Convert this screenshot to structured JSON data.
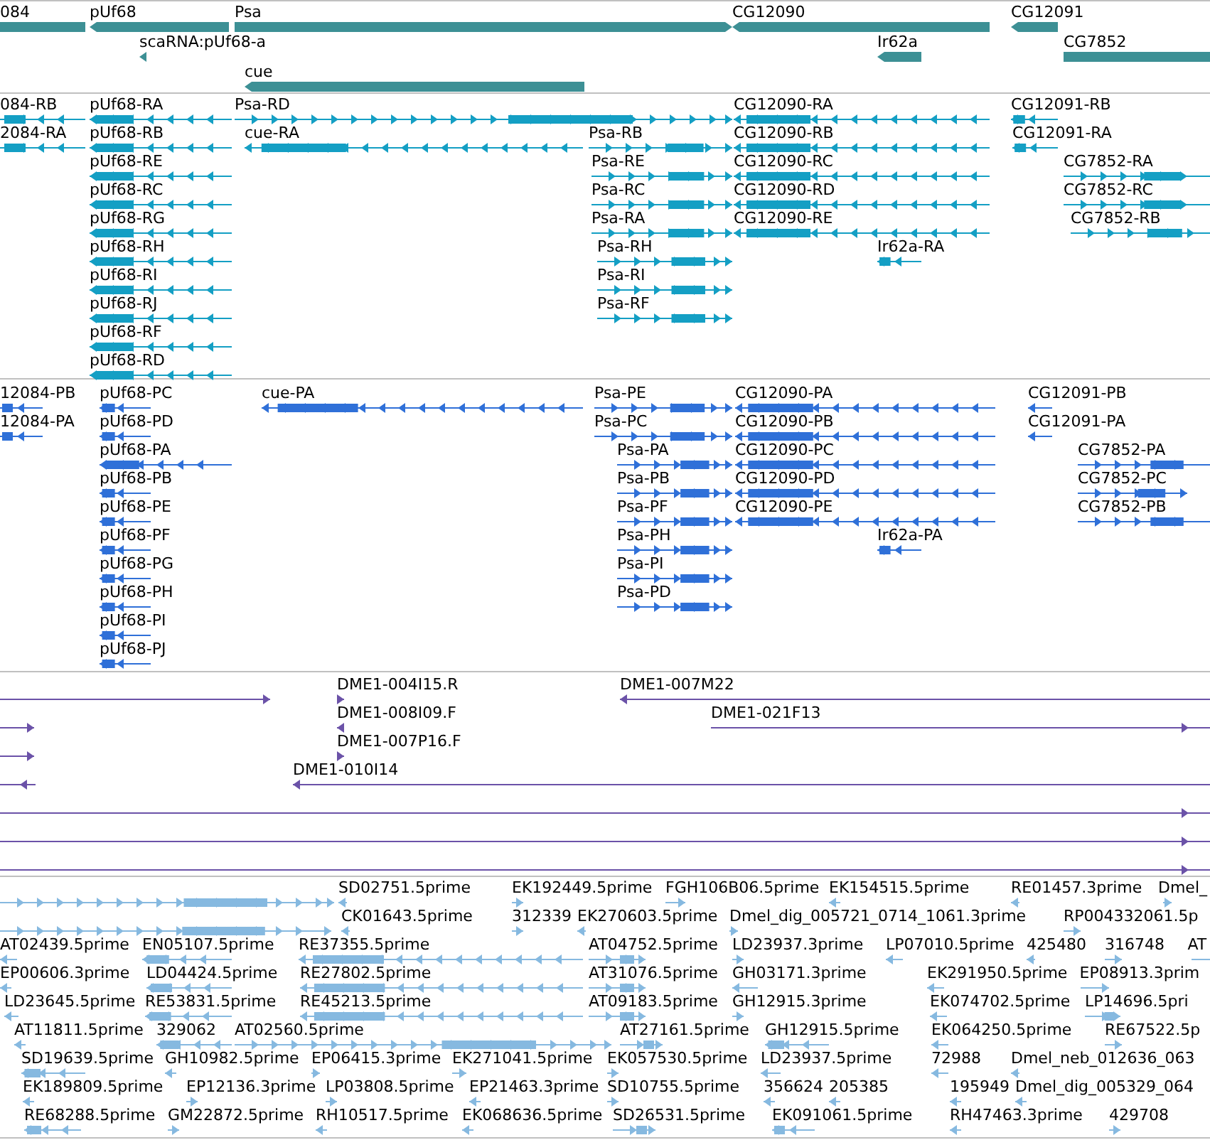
{
  "tracks": [
    {
      "kind": "gene",
      "features": [
        {
          "label": "084",
          "reverse": true
        },
        {
          "label": "pUf68",
          "reverse": true
        },
        {
          "label": "Psa",
          "reverse": false
        },
        {
          "label": "CG12090",
          "reverse": true
        },
        {
          "label": "CG12091",
          "reverse": true
        },
        {
          "label": "scaRNA:pUf68-a",
          "reverse": true
        },
        {
          "label": "Ir62a",
          "reverse": true
        },
        {
          "label": "CG7852",
          "reverse": false
        },
        {
          "label": "cue",
          "reverse": true
        }
      ]
    },
    {
      "kind": "mrna",
      "features": [
        {
          "label": "084-RB",
          "reverse": true
        },
        {
          "label": "pUf68-RA",
          "reverse": true
        },
        {
          "label": "Psa-RD",
          "reverse": false
        },
        {
          "label": "CG12090-RA",
          "reverse": true
        },
        {
          "label": "CG12091-RB",
          "reverse": true
        },
        {
          "label": "2084-RA",
          "reverse": true
        },
        {
          "label": "pUf68-RB",
          "reverse": true
        },
        {
          "label": "cue-RA",
          "reverse": true
        },
        {
          "label": "Psa-RB",
          "reverse": false
        },
        {
          "label": "CG12090-RB",
          "reverse": true
        },
        {
          "label": "CG12091-RA",
          "reverse": true
        },
        {
          "label": "pUf68-RE",
          "reverse": true
        },
        {
          "label": "Psa-RE",
          "reverse": false
        },
        {
          "label": "CG12090-RC",
          "reverse": true
        },
        {
          "label": "CG7852-RA",
          "reverse": false
        },
        {
          "label": "pUf68-RC",
          "reverse": true
        },
        {
          "label": "Psa-RC",
          "reverse": false
        },
        {
          "label": "CG12090-RD",
          "reverse": true
        },
        {
          "label": "CG7852-RC",
          "reverse": false
        },
        {
          "label": "pUf68-RG",
          "reverse": true
        },
        {
          "label": "Psa-RA",
          "reverse": false
        },
        {
          "label": "CG12090-RE",
          "reverse": true
        },
        {
          "label": "CG7852-RB",
          "reverse": false
        },
        {
          "label": "pUf68-RH",
          "reverse": true
        },
        {
          "label": "Psa-RH",
          "reverse": false
        },
        {
          "label": "Ir62a-RA",
          "reverse": true
        },
        {
          "label": "pUf68-RI",
          "reverse": true
        },
        {
          "label": "Psa-RI",
          "reverse": false
        },
        {
          "label": "pUf68-RJ",
          "reverse": true
        },
        {
          "label": "Psa-RF",
          "reverse": false
        },
        {
          "label": "pUf68-RF",
          "reverse": true
        },
        {
          "label": "pUf68-RD",
          "reverse": true
        }
      ]
    },
    {
      "kind": "protein",
      "features": [
        {
          "label": "12084-PB",
          "reverse": true
        },
        {
          "label": "pUf68-PC",
          "reverse": true
        },
        {
          "label": "cue-PA",
          "reverse": true
        },
        {
          "label": "Psa-PE",
          "reverse": false
        },
        {
          "label": "CG12090-PA",
          "reverse": true
        },
        {
          "label": "CG12091-PB",
          "reverse": true
        },
        {
          "label": "12084-PA",
          "reverse": true
        },
        {
          "label": "pUf68-PD",
          "reverse": true
        },
        {
          "label": "Psa-PC",
          "reverse": false
        },
        {
          "label": "CG12090-PB",
          "reverse": true
        },
        {
          "label": "CG12091-PA",
          "reverse": true
        },
        {
          "label": "pUf68-PA",
          "reverse": true
        },
        {
          "label": "Psa-PA",
          "reverse": false
        },
        {
          "label": "CG12090-PC",
          "reverse": true
        },
        {
          "label": "CG7852-PA",
          "reverse": false
        },
        {
          "label": "pUf68-PB",
          "reverse": true
        },
        {
          "label": "Psa-PB",
          "reverse": false
        },
        {
          "label": "CG12090-PD",
          "reverse": true
        },
        {
          "label": "CG7852-PC",
          "reverse": false
        },
        {
          "label": "pUf68-PE",
          "reverse": true
        },
        {
          "label": "Psa-PF",
          "reverse": false
        },
        {
          "label": "CG12090-PE",
          "reverse": true
        },
        {
          "label": "CG7852-PB",
          "reverse": false
        },
        {
          "label": "pUf68-PF",
          "reverse": true
        },
        {
          "label": "Psa-PH",
          "reverse": false
        },
        {
          "label": "Ir62a-PA",
          "reverse": true
        },
        {
          "label": "pUf68-PG",
          "reverse": true
        },
        {
          "label": "Psa-PI",
          "reverse": false
        },
        {
          "label": "pUf68-PH",
          "reverse": true
        },
        {
          "label": "Psa-PD",
          "reverse": false
        },
        {
          "label": "pUf68-PI",
          "reverse": true
        },
        {
          "label": "pUf68-PJ",
          "reverse": true
        }
      ]
    },
    {
      "kind": "clone",
      "features": [
        {
          "reverse": false
        },
        {
          "label": "DME1-004I15.R",
          "reverse": false
        },
        {
          "label": "DME1-007M22",
          "reverse": true
        },
        {
          "reverse": false
        },
        {
          "label": "DME1-008I09.F",
          "reverse": true
        },
        {
          "label": "DME1-021F13",
          "reverse": false
        },
        {
          "reverse": false
        },
        {
          "label": "DME1-007P16.F",
          "reverse": false
        },
        {
          "reverse": true
        },
        {
          "label": "DME1-010I14",
          "reverse": true
        },
        {
          "reverse": false
        },
        {
          "reverse": false
        },
        {
          "reverse": false
        }
      ]
    },
    {
      "kind": "est",
      "features": [
        {
          "reverse": false
        },
        {
          "label": "SD02751.5prime",
          "reverse": true
        },
        {
          "label": "EK192449.5prime",
          "reverse": false
        },
        {
          "label": "FGH106B06.5prime",
          "reverse": false
        },
        {
          "label": "EK154515.5prime",
          "reverse": true
        },
        {
          "label": "RE01457.3prime",
          "reverse": true
        },
        {
          "label": "Dmel_",
          "reverse": false
        },
        {
          "reverse": false
        },
        {
          "label": "CK01643.5prime",
          "reverse": true
        },
        {
          "label": "312339",
          "reverse": false
        },
        {
          "label": "EK270603.5prime",
          "reverse": true
        },
        {
          "label": "Dmel_dig_005721_0714_1061.3prime",
          "reverse": false
        },
        {
          "label": "RP004332061.5p",
          "reverse": false
        },
        {
          "label": "AT02439.5prime",
          "reverse": true
        },
        {
          "label": "EN05107.5prime",
          "reverse": true
        },
        {
          "label": "RE37355.5prime",
          "reverse": true
        },
        {
          "label": "AT04752.5prime",
          "reverse": false
        },
        {
          "label": "LD23937.3prime",
          "reverse": false
        },
        {
          "label": "LP07010.5prime",
          "reverse": true
        },
        {
          "label": "425480",
          "reverse": true
        },
        {
          "label": "316748",
          "reverse": false
        },
        {
          "label": "AT",
          "reverse": false
        },
        {
          "label": "EP00606.3prime",
          "reverse": true
        },
        {
          "label": "LD04424.5prime",
          "reverse": true
        },
        {
          "label": "RE27802.5prime",
          "reverse": true
        },
        {
          "label": "AT31076.5prime",
          "reverse": false
        },
        {
          "label": "GH03171.3prime",
          "reverse": true
        },
        {
          "label": "EK291950.5prime",
          "reverse": true
        },
        {
          "label": "EP08913.3prim",
          "reverse": false
        },
        {
          "label": "LD23645.5prime",
          "reverse": true
        },
        {
          "label": "RE53831.5prime",
          "reverse": true
        },
        {
          "label": "RE45213.5prime",
          "reverse": true
        },
        {
          "label": "AT09183.5prime",
          "reverse": false
        },
        {
          "label": "GH12915.3prime",
          "reverse": false
        },
        {
          "label": "EK074702.5prime",
          "reverse": true
        },
        {
          "label": "LP14696.5pri",
          "reverse": false
        },
        {
          "label": "AT11811.5prime",
          "reverse": true
        },
        {
          "label": "329062",
          "reverse": true
        },
        {
          "label": "AT02560.5prime",
          "reverse": false
        },
        {
          "label": "AT27161.5prime",
          "reverse": false
        },
        {
          "label": "GH12915.5prime",
          "reverse": true
        },
        {
          "label": "EK064250.5prime",
          "reverse": true
        },
        {
          "label": "RE67522.5p",
          "reverse": false
        },
        {
          "label": "SD19639.5prime",
          "reverse": true
        },
        {
          "label": "GH10982.5prime",
          "reverse": true
        },
        {
          "label": "EP06415.3prime",
          "reverse": false
        },
        {
          "label": "EK271041.5prime",
          "reverse": false
        },
        {
          "label": "EK057530.5prime",
          "reverse": false
        },
        {
          "label": "LD23937.5prime",
          "reverse": true
        },
        {
          "label": "72988",
          "reverse": true
        },
        {
          "label": "Dmel_neb_012636_063",
          "reverse": true
        },
        {
          "label": "EK189809.5prime",
          "reverse": true
        },
        {
          "label": "EP12136.3prime",
          "reverse": false
        },
        {
          "label": "LP03808.5prime",
          "reverse": false
        },
        {
          "label": "EP21463.3prime",
          "reverse": true
        },
        {
          "label": "SD10755.5prime",
          "reverse": false
        },
        {
          "label": "356624",
          "reverse": true
        },
        {
          "label": "205385",
          "reverse": true
        },
        {
          "label": "195949",
          "reverse": true
        },
        {
          "label": "Dmel_dig_005329_064",
          "reverse": true
        },
        {
          "label": "RE68288.5prime",
          "reverse": true
        },
        {
          "label": "GM22872.5prime",
          "reverse": false
        },
        {
          "label": "RH10517.5prime",
          "reverse": true
        },
        {
          "label": "EK068636.5prime",
          "reverse": true
        },
        {
          "label": "SD26531.5prime",
          "reverse": false
        },
        {
          "label": "EK091061.5prime",
          "reverse": true
        },
        {
          "label": "RH47463.3prime",
          "reverse": true
        },
        {
          "label": "429708",
          "reverse": false
        }
      ]
    }
  ]
}
